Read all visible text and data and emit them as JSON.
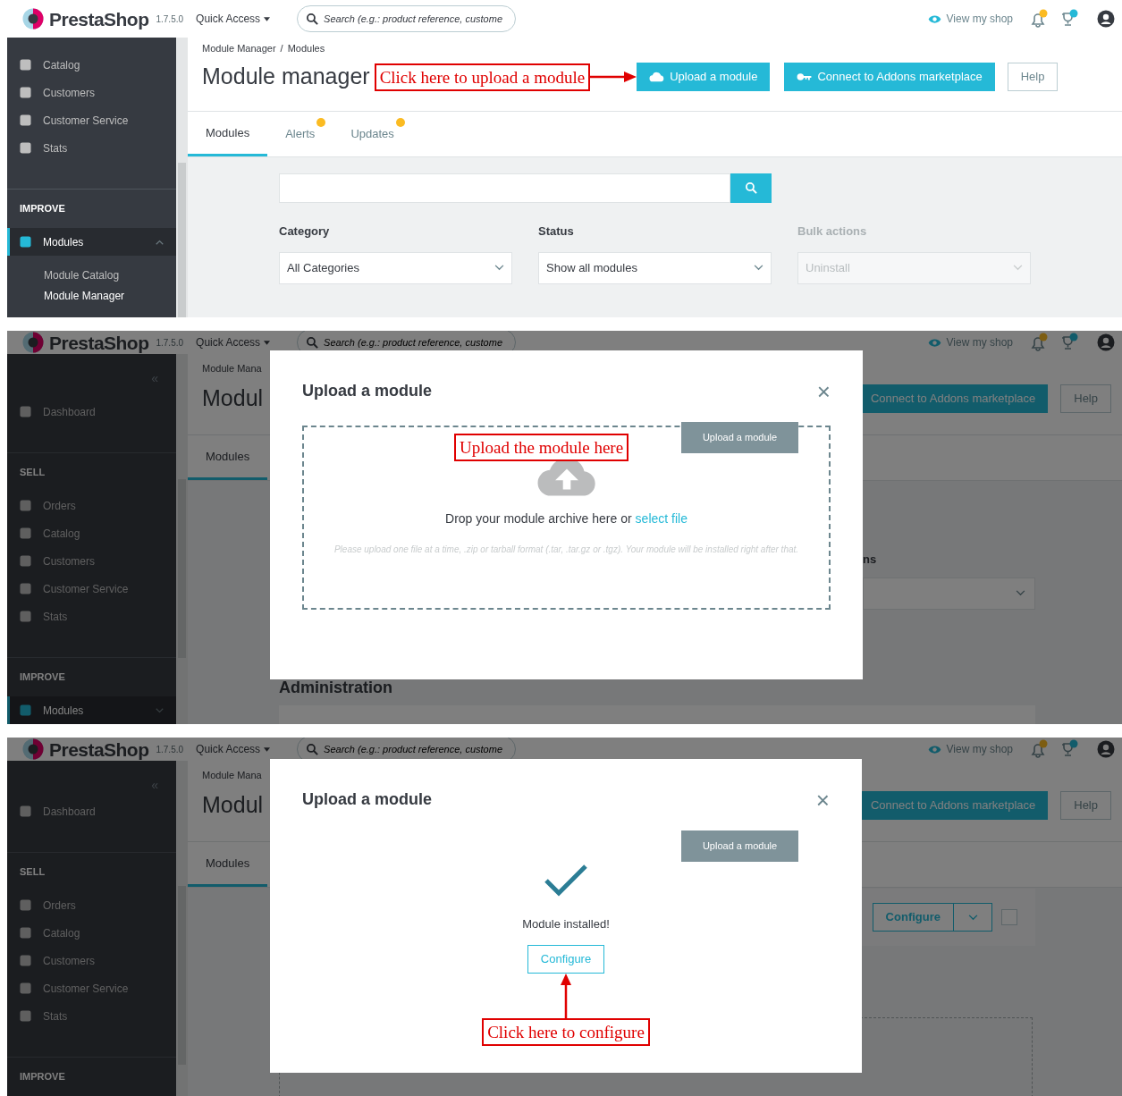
{
  "panels": [
    {
      "kind": "manager",
      "topbar": {
        "brand": "PrestaShop",
        "version": "1.7.5.0",
        "quick_access": "Quick Access",
        "search_placeholder": "Search (e.g.: product reference, custome",
        "view_shop": "View my shop"
      },
      "sidebar": [
        {
          "kind": "item",
          "label": "Catalog",
          "selected": false
        },
        {
          "kind": "item",
          "label": "Customers",
          "selected": false
        },
        {
          "kind": "item",
          "label": "Customer Service",
          "selected": false
        },
        {
          "kind": "item",
          "label": "Stats",
          "selected": false
        },
        {
          "kind": "section",
          "label": "IMPROVE"
        },
        {
          "kind": "item",
          "label": "Modules",
          "selected": true,
          "expanded": true,
          "children": [
            {
              "label": "Module Catalog",
              "selected": false
            },
            {
              "label": "Module Manager",
              "selected": true
            }
          ]
        }
      ],
      "breadcrumb": {
        "items": [
          "Module Manager",
          "Modules"
        ],
        "separator": "/"
      },
      "title": "Module manager",
      "callout": "Click here to upload a module",
      "buttons": [
        {
          "kind": "upload",
          "label": "Upload a module"
        },
        {
          "kind": "addons",
          "label": "Connect to Addons marketplace"
        },
        {
          "kind": "outline",
          "label": "Help"
        }
      ],
      "tabs": [
        {
          "label": "Modules",
          "selected": true,
          "badge": false
        },
        {
          "label": "Alerts",
          "selected": false,
          "badge": true
        },
        {
          "label": "Updates",
          "selected": false,
          "badge": true
        }
      ],
      "filters": [
        {
          "label": "Category",
          "value": "All Categories",
          "disabled": false
        },
        {
          "label": "Status",
          "value": "Show all modules",
          "disabled": false
        },
        {
          "label": "Bulk actions",
          "value": "Uninstall",
          "disabled": true
        }
      ]
    },
    {
      "kind": "upload",
      "topbar": {
        "brand": "PrestaShop",
        "version": "1.7.5.0",
        "quick_access": "Quick Access",
        "search_placeholder": "Search (e.g.: product reference, custome",
        "view_shop": "View my shop"
      },
      "sidebar": [
        {
          "kind": "collapse",
          "label": "«"
        },
        {
          "kind": "item",
          "label": "Dashboard",
          "selected": false
        },
        {
          "kind": "section",
          "label": "SELL"
        },
        {
          "kind": "item",
          "label": "Orders",
          "selected": false
        },
        {
          "kind": "item",
          "label": "Catalog",
          "selected": false
        },
        {
          "kind": "item",
          "label": "Customers",
          "selected": false
        },
        {
          "kind": "item",
          "label": "Customer Service",
          "selected": false
        },
        {
          "kind": "item",
          "label": "Stats",
          "selected": false
        },
        {
          "kind": "section",
          "label": "IMPROVE"
        },
        {
          "kind": "item",
          "label": "Modules",
          "selected": true,
          "expanded": false
        }
      ],
      "breadcrumb": {
        "items": [
          "Module Mana"
        ]
      },
      "title": "Modul",
      "buttons": [
        {
          "kind": "addons_plain",
          "label": "Connect to Addons marketplace"
        },
        {
          "kind": "outline",
          "label": "Help"
        }
      ],
      "tabs": [
        {
          "label": "Modules",
          "selected": true,
          "badge": false
        }
      ],
      "behind": {
        "kind": "bulk",
        "label": "ns",
        "heading": "Administration"
      },
      "modal": {
        "title": "Upload a module",
        "close": "×",
        "tooltip": "Upload a module",
        "callout": "Upload the module here",
        "drop_text": "Drop your module archive here or",
        "link": "select file",
        "hint": "Please upload one file at a time, .zip or tarball format (.tar, .tar.gz or .tgz). Your module will be installed right after that."
      }
    },
    {
      "kind": "installed",
      "topbar": {
        "brand": "PrestaShop",
        "version": "1.7.5.0",
        "quick_access": "Quick Access",
        "search_placeholder": "Search (e.g.: product reference, custome",
        "view_shop": "View my shop"
      },
      "sidebar": [
        {
          "kind": "collapse",
          "label": "«"
        },
        {
          "kind": "item",
          "label": "Dashboard",
          "selected": false
        },
        {
          "kind": "section",
          "label": "SELL"
        },
        {
          "kind": "item",
          "label": "Orders",
          "selected": false
        },
        {
          "kind": "item",
          "label": "Catalog",
          "selected": false
        },
        {
          "kind": "item",
          "label": "Customers",
          "selected": false
        },
        {
          "kind": "item",
          "label": "Customer Service",
          "selected": false
        },
        {
          "kind": "item",
          "label": "Stats",
          "selected": false
        },
        {
          "kind": "section",
          "label": "IMPROVE"
        }
      ],
      "breadcrumb": {
        "items": [
          "Module Mana"
        ]
      },
      "title": "Modul",
      "buttons": [
        {
          "kind": "addons_plain",
          "label": "Connect to Addons marketplace"
        },
        {
          "kind": "outline",
          "label": "Help"
        }
      ],
      "tabs": [
        {
          "label": "Modules",
          "selected": true,
          "badge": false
        }
      ],
      "behind": {
        "kind": "configure",
        "button": "Configure",
        "checked": false
      },
      "modal": {
        "title": "Upload a module",
        "close": "×",
        "tooltip": "Upload a module",
        "status": "Module installed!",
        "button": "Configure",
        "callout": "Click here to configure"
      }
    }
  ]
}
